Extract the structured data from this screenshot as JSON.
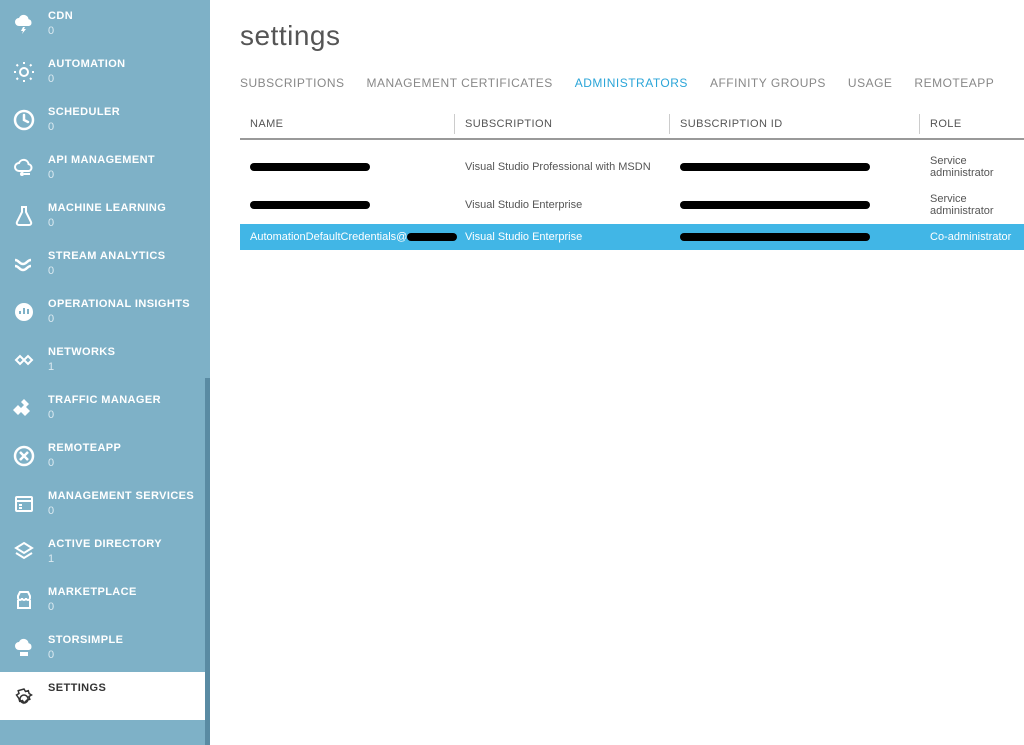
{
  "page_title": "settings",
  "sidebar": {
    "items": [
      {
        "label": "CDN",
        "count": "0",
        "icon": "cloud-bolt-icon"
      },
      {
        "label": "AUTOMATION",
        "count": "0",
        "icon": "gear-sparkle-icon"
      },
      {
        "label": "SCHEDULER",
        "count": "0",
        "icon": "clock-icon"
      },
      {
        "label": "API MANAGEMENT",
        "count": "0",
        "icon": "cloud-key-icon"
      },
      {
        "label": "MACHINE LEARNING",
        "count": "0",
        "icon": "flask-icon"
      },
      {
        "label": "STREAM ANALYTICS",
        "count": "0",
        "icon": "stream-icon"
      },
      {
        "label": "OPERATIONAL INSIGHTS",
        "count": "0",
        "icon": "insights-icon"
      },
      {
        "label": "NETWORKS",
        "count": "1",
        "icon": "network-icon"
      },
      {
        "label": "TRAFFIC MANAGER",
        "count": "0",
        "icon": "traffic-icon"
      },
      {
        "label": "REMOTEAPP",
        "count": "0",
        "icon": "remoteapp-icon"
      },
      {
        "label": "MANAGEMENT SERVICES",
        "count": "0",
        "icon": "mgmt-services-icon"
      },
      {
        "label": "ACTIVE DIRECTORY",
        "count": "1",
        "icon": "active-directory-icon"
      },
      {
        "label": "MARKETPLACE",
        "count": "0",
        "icon": "marketplace-icon"
      },
      {
        "label": "STORSIMPLE",
        "count": "0",
        "icon": "storsimple-icon"
      },
      {
        "label": "SETTINGS",
        "count": "",
        "icon": "gear-icon",
        "active": true
      }
    ]
  },
  "tabs": [
    {
      "label": "SUBSCRIPTIONS",
      "active": false
    },
    {
      "label": "MANAGEMENT CERTIFICATES",
      "active": false
    },
    {
      "label": "ADMINISTRATORS",
      "active": true
    },
    {
      "label": "AFFINITY GROUPS",
      "active": false
    },
    {
      "label": "USAGE",
      "active": false
    },
    {
      "label": "REMOTEAPP",
      "active": false
    }
  ],
  "table": {
    "headers": [
      "NAME",
      "SUBSCRIPTION",
      "SUBSCRIPTION ID",
      "ROLE"
    ],
    "rows": [
      {
        "name_redacted": true,
        "subid_redacted": true,
        "subscription": "Visual Studio Professional with MSDN",
        "role": "Service administrator",
        "selected": false
      },
      {
        "name_redacted": true,
        "subid_redacted": true,
        "subscription": "Visual Studio Enterprise",
        "role": "Service administrator",
        "selected": false
      },
      {
        "name_prefix": "AutomationDefaultCredentials@",
        "name_redacted_tail": true,
        "subid_redacted": true,
        "subscription": "Visual Studio Enterprise",
        "role": "Co-administrator",
        "selected": true
      }
    ]
  }
}
